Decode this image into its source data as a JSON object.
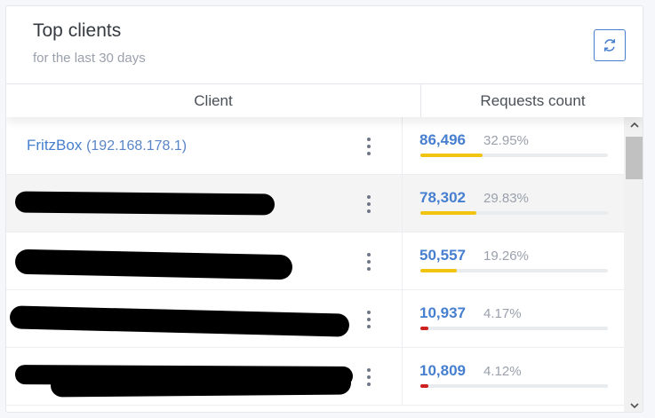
{
  "card": {
    "title": "Top clients",
    "subtitle": "for the last 30 days",
    "refresh_icon": "refresh-icon"
  },
  "table": {
    "columns": [
      "Client",
      "Requests count"
    ],
    "rows": [
      {
        "name": "FritzBox",
        "ip": "(192.168.178.1)",
        "redacted": false,
        "count": "86,496",
        "percent": "32.95%",
        "bar_fraction": 0.3295,
        "bar_color": "#f1c40f"
      },
      {
        "name": "",
        "ip": "",
        "redacted": true,
        "count": "78,302",
        "percent": "29.83%",
        "bar_fraction": 0.2983,
        "bar_color": "#f1c40f"
      },
      {
        "name": "",
        "ip": "",
        "redacted": true,
        "count": "50,557",
        "percent": "19.26%",
        "bar_fraction": 0.1926,
        "bar_color": "#f1c40f"
      },
      {
        "name": "",
        "ip": "",
        "redacted": true,
        "count": "10,937",
        "percent": "4.17%",
        "bar_fraction": 0.0417,
        "bar_color": "#cd201f"
      },
      {
        "name": "",
        "ip": "",
        "redacted": true,
        "count": "10,809",
        "percent": "4.12%",
        "bar_fraction": 0.0412,
        "bar_color": "#cd201f"
      }
    ]
  },
  "colors": {
    "accent": "#467fcf",
    "bar_high": "#f1c40f",
    "bar_low": "#cd201f"
  }
}
